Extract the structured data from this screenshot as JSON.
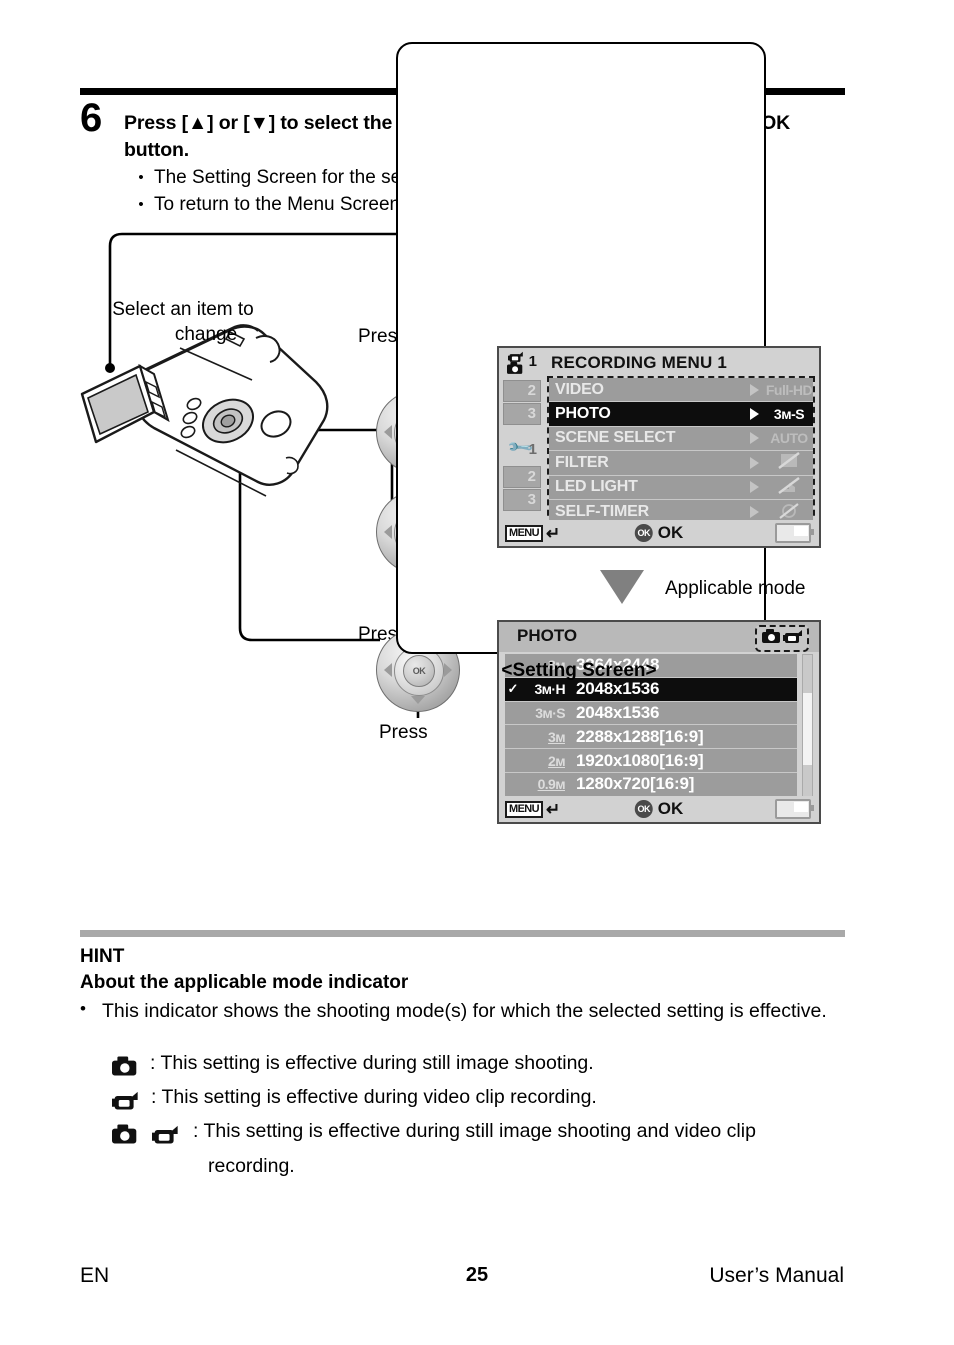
{
  "step": {
    "number": "6",
    "heading": "Press [▲] or [▼] to select the item you wish to change, and press the OK button.",
    "bullets": [
      "The Setting Screen for the selected item appears.",
      "To return to the Menu Screen, press the MENU button."
    ],
    "bullet_marker": "•"
  },
  "figure": {
    "pad_up_label": "Press [▲]",
    "pad_down_label": "Press [▼]",
    "pad_ok_label": "Press",
    "ok_pad_text": "OK",
    "callout_select": "Select an item to",
    "callout_select_line2": "change",
    "callout_applicable": "Applicable mode",
    "setting_screen_caption": "<Setting Screen>"
  },
  "menu_screen": {
    "title": "RECORDING MENU 1",
    "side_tabs_rec": [
      "1",
      "2",
      "3"
    ],
    "side_tabs_setup": [
      "1",
      "2",
      "3"
    ],
    "rows": [
      {
        "label": "VIDEO",
        "value": "Full-HD",
        "selected": false
      },
      {
        "label": "PHOTO",
        "value": "3ᴍ-S",
        "selected": true
      },
      {
        "label": "SCENE SELECT",
        "value": "AUTO",
        "selected": false
      },
      {
        "label": "FILTER",
        "value": "",
        "selected": false
      },
      {
        "label": "LED LIGHT",
        "value": "",
        "selected": false
      },
      {
        "label": "SELF-TIMER",
        "value": "",
        "selected": false
      }
    ],
    "bottom_bar": {
      "menu_key": "MENU",
      "return_glyph": "↵",
      "ok_badge": "OK",
      "ok_label": "OK"
    }
  },
  "setting_screen": {
    "title": "PHOTO",
    "mode_icons": [
      "still-camera-icon",
      "video-camera-icon"
    ],
    "rows": [
      {
        "size": "8ᴍ",
        "underline": false,
        "dimensions": "3264x2448",
        "checked": false,
        "selected": false
      },
      {
        "size": "3ᴍ·H",
        "underline": false,
        "dimensions": "2048x1536",
        "checked": true,
        "selected": true
      },
      {
        "size": "3ᴍ·S",
        "underline": false,
        "dimensions": "2048x1536",
        "checked": false,
        "selected": false
      },
      {
        "size": "3ᴍ",
        "underline": true,
        "dimensions": "2288x1288[16:9]",
        "checked": false,
        "selected": false
      },
      {
        "size": "2ᴍ",
        "underline": true,
        "dimensions": "1920x1080[16:9]",
        "checked": false,
        "selected": false
      },
      {
        "size": "0.9ᴍ",
        "underline": true,
        "dimensions": "1280x720[16:9]",
        "checked": false,
        "selected": false
      }
    ],
    "bottom_bar": {
      "menu_key": "MENU",
      "return_glyph": "↵",
      "ok_badge": "OK",
      "ok_label": "OK"
    }
  },
  "hint": {
    "title": "HINT",
    "subtitle": "About the applicable mode indicator",
    "bullet_marker": "•",
    "body": "This indicator shows the shooting mode(s) for which the selected setting is effective.",
    "items": [
      {
        "icons": [
          "still-camera-icon"
        ],
        "text": ": This setting is effective during still image shooting."
      },
      {
        "icons": [
          "video-camera-icon"
        ],
        "text": ": This setting is effective during video clip recording."
      },
      {
        "icons": [
          "still-camera-icon",
          "video-camera-icon"
        ],
        "text": ": This setting is effective during still image shooting and video clip",
        "continuation": "recording."
      }
    ]
  },
  "footer": {
    "language": "EN",
    "page": "25",
    "manual": "User’s Manual"
  }
}
